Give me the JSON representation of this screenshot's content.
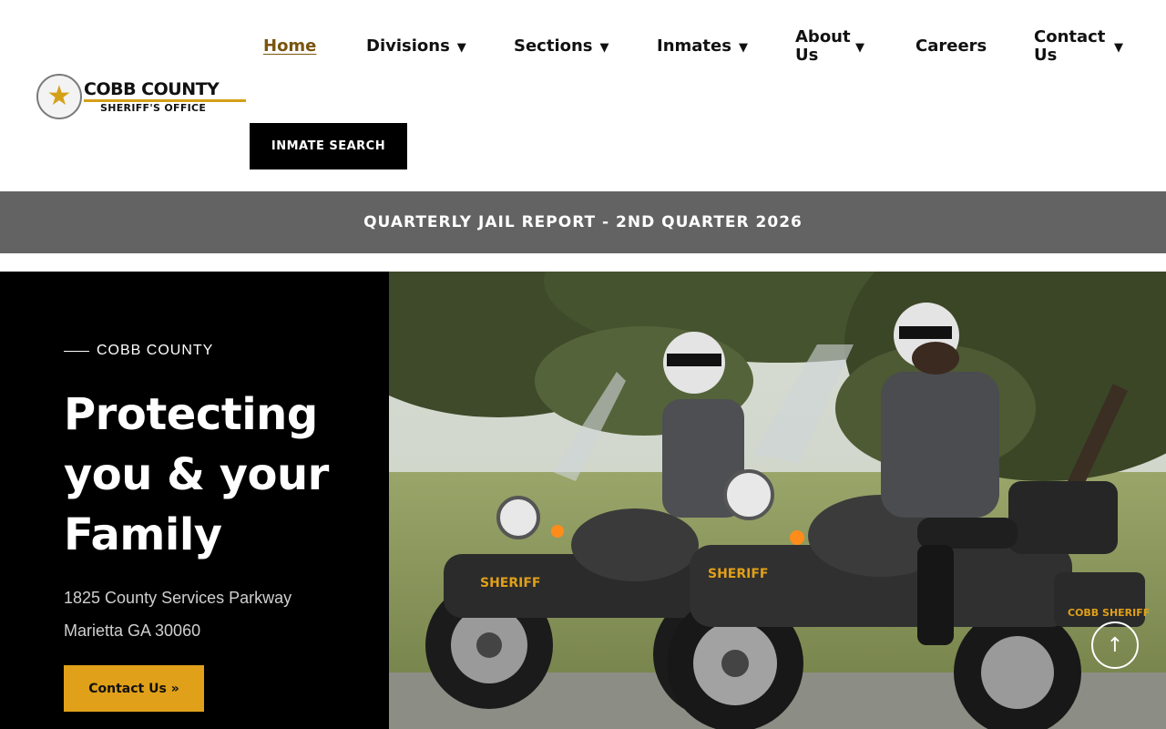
{
  "header": {
    "logo": {
      "line1": "COBB COUNTY",
      "line2": "SHERIFF'S OFFICE",
      "seal_text": "COBB COUNTY SHERIFF'S OFFICE"
    },
    "nav": [
      {
        "label": "Home",
        "has_dropdown": false,
        "active": true
      },
      {
        "label": "Divisions",
        "has_dropdown": true
      },
      {
        "label": "Sections",
        "has_dropdown": true
      },
      {
        "label": "Inmates",
        "has_dropdown": true
      },
      {
        "label": "About Us",
        "has_dropdown": true
      },
      {
        "label": "Careers",
        "has_dropdown": false
      },
      {
        "label": "Contact Us",
        "has_dropdown": true
      }
    ],
    "dropdown_glyph": "▼",
    "inmate_search_label": "INMATE SEARCH"
  },
  "banner": {
    "text": "QUARTERLY JAIL REPORT - 2ND QUARTER 2026"
  },
  "hero": {
    "eyebrow": "COBB COUNTY",
    "title": "Protecting you & your Family",
    "address_line1": "1825 County Services Parkway",
    "address_line2": "Marietta GA 30060",
    "cta_label": "Contact Us »",
    "photo": {
      "motorcycle_label": "SHERIFF",
      "rear_box_label": "COBB SHERIFF"
    }
  },
  "scroll_top_icon": "arrow-up-icon",
  "colors": {
    "accent": "#e0a019",
    "active_nav": "#7a5410",
    "banner_bg": "#636363",
    "hero_left_bg": "#000000"
  }
}
